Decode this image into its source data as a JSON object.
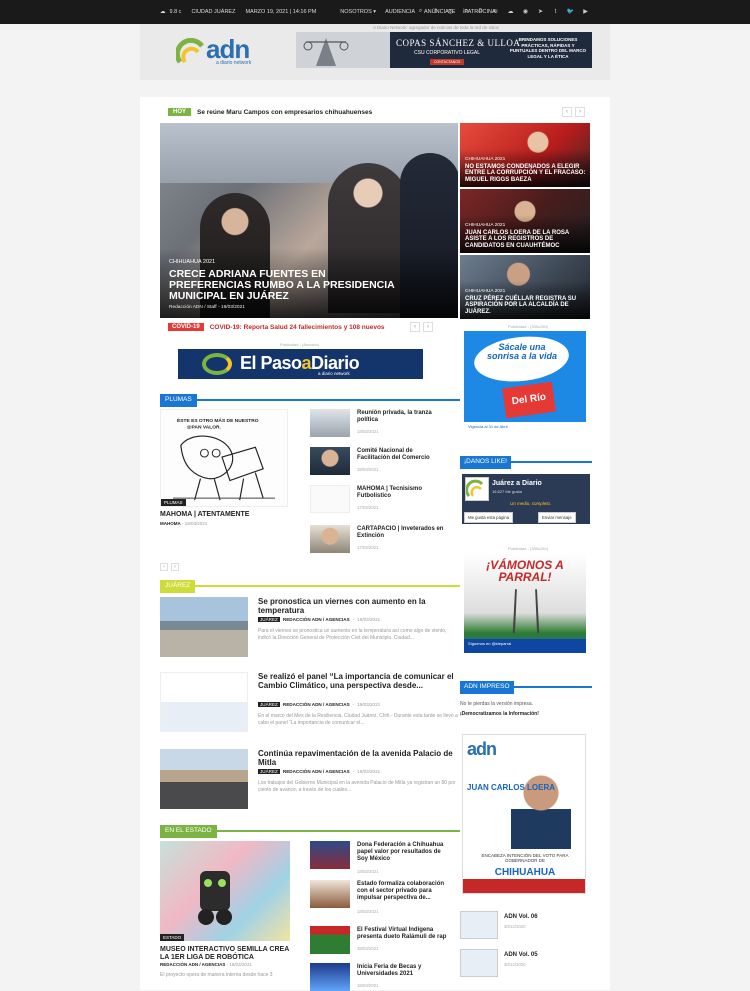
{
  "topbar": {
    "weather": "9.8 c",
    "city": "CIUDAD JUÁREZ",
    "datetime": "MARZO 19, 2021 | 14:16 PM",
    "menu": [
      "NOSOTROS",
      "AUDIENCIA",
      "ANÚNCIATE",
      "PATROCINA"
    ],
    "social_icons": [
      "search-icon",
      "facebook-icon",
      "instagram-icon",
      "linkedin-icon",
      "pinterest-icon",
      "rss-icon",
      "soundcloud-icon",
      "spotify-icon",
      "telegram-icon",
      "tumblr-icon",
      "twitter-icon",
      "youtube-icon"
    ]
  },
  "header": {
    "tagline": "A Diario Network: agregador de noticias de toda la red de sitios",
    "logo_text": "adn",
    "logo_sub": "a diario network",
    "banner": {
      "firm": "COPAS SÁNCHEZ & ULLOA",
      "firm_sub": "CSU CORPORATIVO LEGAL",
      "cta": "CONTACTANOS",
      "right_text": "BRINDAMOS SOLUCIONES PRÁCTICAS, RÁPIDAS Y PUNTUALES DENTRO DEL MARCO LEGAL Y LA ÉTICA"
    }
  },
  "ticker": {
    "label": "HOY",
    "text": "Se reúne Maru Campos con empresarios chihuahuenses"
  },
  "hero": {
    "category": "CHIHUAHUA 2021",
    "title": "CRECE ADRIANA FUENTES EN PREFERENCIAS RUMBO A LA PRESIDENCIA MUNICIPAL EN JUÁREZ",
    "meta": "Redacción ADN / Staff  -  19/03/2021"
  },
  "side_cards": [
    {
      "category": "CHIHUAHUA 2021",
      "title": "NO ESTAMOS CONDENADOS A ELEGIR ENTRE LA CORRUPCIÓN Y EL FRACASO: MIGUEL RIGGS BAEZA"
    },
    {
      "category": "CHIHUAHUA 2021",
      "title": "JUAN CARLOS LOERA DE LA ROSA ASISTE A LOS REGISTROS DE CANDIDATOS EN CUAUHTÉMOC"
    },
    {
      "category": "CHIHUAHUA 2021",
      "title": "CRUZ PÉREZ CUÉLLAR REGISTRA SU ASPIRACIÓN POR LA ALCALDÍA DE JUÁREZ."
    }
  ],
  "covid": {
    "label": "COVID-19",
    "text": "COVID-19: Reporta Salud 24 fallecimientos y 108 nuevos"
  },
  "ads": {
    "publicidad_label": "Publicidad - (Anuncio)",
    "sidebar_label": "Publicidad - (300x250)",
    "elpaso_text_a": "El Paso",
    "elpaso_text_b": "Diario",
    "elpaso_sub": "a diario network"
  },
  "plumas": {
    "header": "PLUMAS",
    "tag": "PLUMAS",
    "main_title": "MAHOMA | ATENTAMENTE",
    "main_author": "MAHOMA",
    "main_date": "18/03/2021",
    "items": [
      {
        "title": "Reunión privada, la tranza política",
        "date": "18/03/2021"
      },
      {
        "title": "Comité Nacional de Facilitación del Comercio",
        "date": "18/03/2021"
      },
      {
        "title": "MAHOMA | Tecnisismo Futbolístico",
        "date": "17/03/2021"
      },
      {
        "title": "CARTAPACIO | Inveterados en Extinción",
        "date": "17/03/2021"
      }
    ]
  },
  "juarez": {
    "header": "JUÁREZ",
    "articles": [
      {
        "title": "Se pronostica un viernes con aumento en la temperatura",
        "cat": "JUÁREZ",
        "author": "REDACCIÓN ADN / AGENCIAS",
        "date": "19/03/2021",
        "excerpt": "Para el viernes se pronostica un aumento en la temperatura así como algo de viento, indicó la Dirección General de Protección Civil del Municipio. Ciudad..."
      },
      {
        "title": "Se realizó el panel “La importancia de comunicar el Cambio Climático, una perspectiva desde...",
        "cat": "JUÁREZ",
        "author": "REDACCIÓN ADN / AGENCIAS",
        "date": "19/03/2021",
        "excerpt": "En el marco del Mes de la Resiliencia. Ciudad Juárez, Chih.- Durante esta tarde se llevó a cabo el panel “La importancia de comunicar el..."
      },
      {
        "title": "Continúa repavimentación de la avenida Palacio de Mitla",
        "cat": "JUÁREZ",
        "author": "REDACCIÓN ADN / AGENCIAS",
        "date": "19/03/2021",
        "excerpt": "Los trabajos del Gobierno Municipal en la avenida Palacio de Mitla ya registran un 80 por ciento de avance, a través de los cuales..."
      }
    ]
  },
  "estado": {
    "header": "EN EL ESTADO",
    "tag": "ESTADO",
    "main_title": "MUSEO INTERACTIVO SEMILLA CREA LA 1ER LIGA DE ROBÓTICA",
    "main_author": "REDACCIÓN ADN / AGENCIAS",
    "main_date": "18/03/2021",
    "main_excerpt": "El proyecto opera de manera interna desde hace 3",
    "items": [
      {
        "title": "Dona Federación a Chihuahua papel valor por resultados de Soy México",
        "date": "18/03/2021"
      },
      {
        "title": "Estado formaliza colaboración con el sector privado para impulsar perspectiva de...",
        "date": "18/03/2021"
      },
      {
        "title": "El Festival Virtual Indígena presenta dueto Ralámuli de rap",
        "date": "18/03/2021"
      },
      {
        "title": "Inicia Feria de Becas y Universidades 2021",
        "date": "18/03/2021"
      }
    ]
  },
  "sidebar": {
    "sonrisa_text": "Sácale una sonrisa a la vida",
    "sonrisa_brand": "Del Río",
    "sonrisa_foot": "Vigencia al 31 de Abril",
    "danos_like": "¡DANOS LIKE!",
    "fb_name": "Juárez a Diario",
    "fb_followers": "16.627 Me gusta",
    "fb_slogan": "Un medio, completo.",
    "fb_like": "Me gusta esta página",
    "fb_message": "Enviar mensaje",
    "parral_text": "¡VÁMONOS A PARRAL!",
    "parral_foot": "Síguenos en @ideparral",
    "adn_impreso": "ADN IMPRESO",
    "impreso_line1": "No te pierdas la versión impresa.",
    "impreso_line2": "¡Democratizamos la Información!",
    "magazine_mast": "adn",
    "magazine_name": "JUAN CARLOS LOERA",
    "magazine_sub": "ENCABEZA INTENCIÓN DEL VOTO PARA GOBERNADOR DE",
    "magazine_big": "CHIHUAHUA",
    "volumes": [
      {
        "title": "ADN Vol. 06",
        "date": "30/12/2020"
      },
      {
        "title": "ADN Vol. 05",
        "date": "30/12/2020"
      }
    ]
  }
}
